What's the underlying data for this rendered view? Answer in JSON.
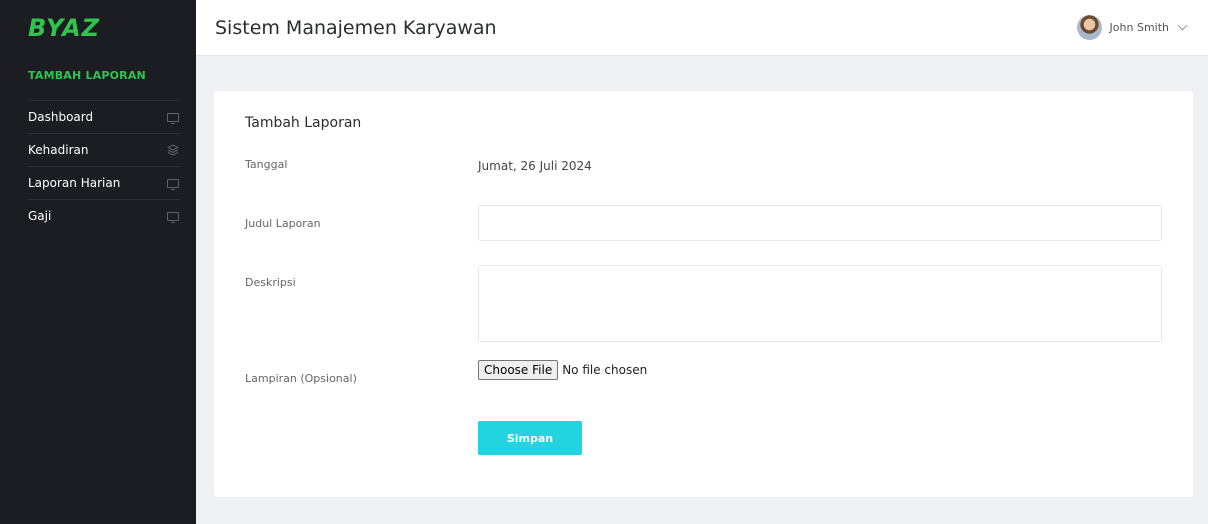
{
  "brand": {
    "logo_text": "BYAZ",
    "logo_color": "#2fc44e"
  },
  "sidebar": {
    "section_title": "TAMBAH LAPORAN",
    "items": [
      {
        "label": "Dashboard",
        "icon": "monitor-icon"
      },
      {
        "label": "Kehadiran",
        "icon": "layers-icon"
      },
      {
        "label": "Laporan Harian",
        "icon": "monitor-icon"
      },
      {
        "label": "Gaji",
        "icon": "monitor-icon"
      }
    ]
  },
  "header": {
    "title": "Sistem Manajemen Karyawan",
    "user_name": "John Smith"
  },
  "form": {
    "title": "Tambah Laporan",
    "date_label": "Tanggal",
    "date_value": "Jumat, 26 Juli 2024",
    "title_label": "Judul Laporan",
    "title_value": "",
    "description_label": "Deskripsi",
    "description_value": "",
    "attachment_label": "Lampiran (Opsional)",
    "file_button_label": "Choose File",
    "file_status": "No file chosen",
    "submit_label": "Simpan",
    "accent_color": "#22d4df"
  }
}
